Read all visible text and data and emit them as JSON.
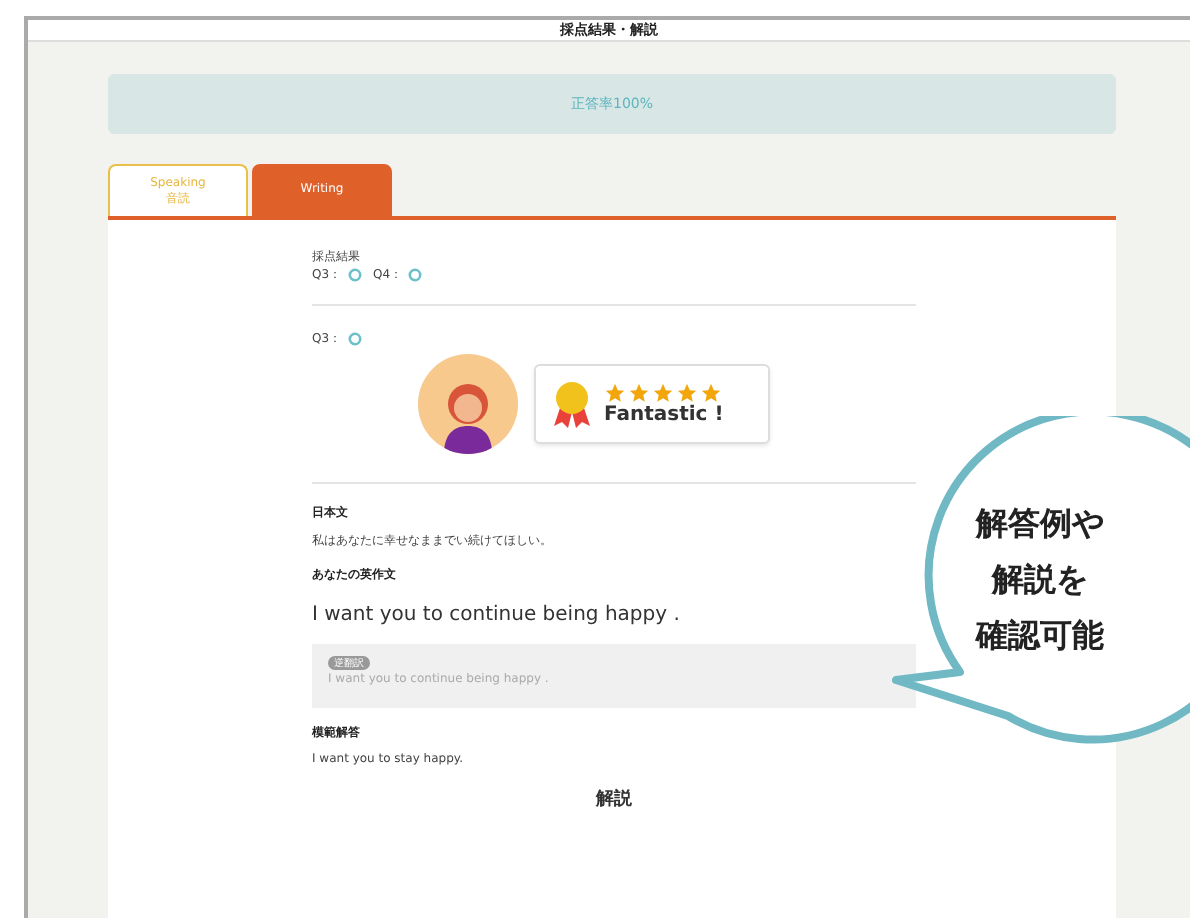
{
  "window": {
    "title": "採点結果・解説"
  },
  "banner": {
    "text": "正答率100%"
  },
  "tabs": [
    {
      "label": "Speaking",
      "sublabel": "音読",
      "selected": false
    },
    {
      "label": "Writing",
      "selected": true
    }
  ],
  "summary": {
    "heading": "採点結果",
    "results": [
      {
        "label": "Q3：",
        "correct": true
      },
      {
        "label": "Q4：",
        "correct": true
      }
    ]
  },
  "question": {
    "label": "Q3：",
    "correct": true
  },
  "feedback": {
    "stars": 5,
    "message": "Fantastic !"
  },
  "japanese": {
    "heading": "日本文",
    "text": "私はあなたに幸せなままでい続けてほしい。"
  },
  "answer": {
    "heading": "あなたの英作文",
    "text": "I want you to continue being happy .",
    "badge": "逆翻訳",
    "back_text": "I want you to continue being happy ."
  },
  "model": {
    "heading": "模範解答",
    "text": "I want you to stay happy."
  },
  "explanation": {
    "heading": "解説"
  },
  "callout": {
    "lines": [
      "解答例や",
      "解説を",
      "確認可能"
    ]
  }
}
